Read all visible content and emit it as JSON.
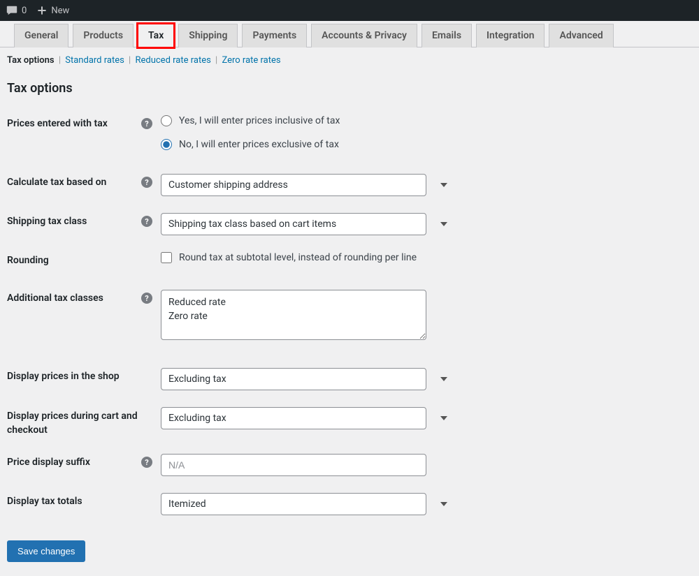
{
  "adminbar": {
    "comments_count": "0",
    "new_label": "New"
  },
  "tabs": {
    "items": [
      "General",
      "Products",
      "Tax",
      "Shipping",
      "Payments",
      "Accounts & Privacy",
      "Emails",
      "Integration",
      "Advanced"
    ],
    "active": "Tax"
  },
  "subnav": {
    "current": "Tax options",
    "links": [
      "Standard rates",
      "Reduced rate rates",
      "Zero rate rates"
    ]
  },
  "section_title": "Tax options",
  "fields": {
    "prices_entered": {
      "label": "Prices entered with tax",
      "option_yes": "Yes, I will enter prices inclusive of tax",
      "option_no": "No, I will enter prices exclusive of tax",
      "selected": "no"
    },
    "calculate_based": {
      "label": "Calculate tax based on",
      "value": "Customer shipping address"
    },
    "shipping_tax_class": {
      "label": "Shipping tax class",
      "value": "Shipping tax class based on cart items"
    },
    "rounding": {
      "label": "Rounding",
      "checkbox_label": "Round tax at subtotal level, instead of rounding per line"
    },
    "additional_tax_classes": {
      "label": "Additional tax classes",
      "value": "Reduced rate\nZero rate"
    },
    "display_shop": {
      "label": "Display prices in the shop",
      "value": "Excluding tax"
    },
    "display_cart": {
      "label": "Display prices during cart and checkout",
      "value": "Excluding tax"
    },
    "price_suffix": {
      "label": "Price display suffix",
      "placeholder": "N/A",
      "value": ""
    },
    "display_totals": {
      "label": "Display tax totals",
      "value": "Itemized"
    }
  },
  "save_button": "Save changes"
}
